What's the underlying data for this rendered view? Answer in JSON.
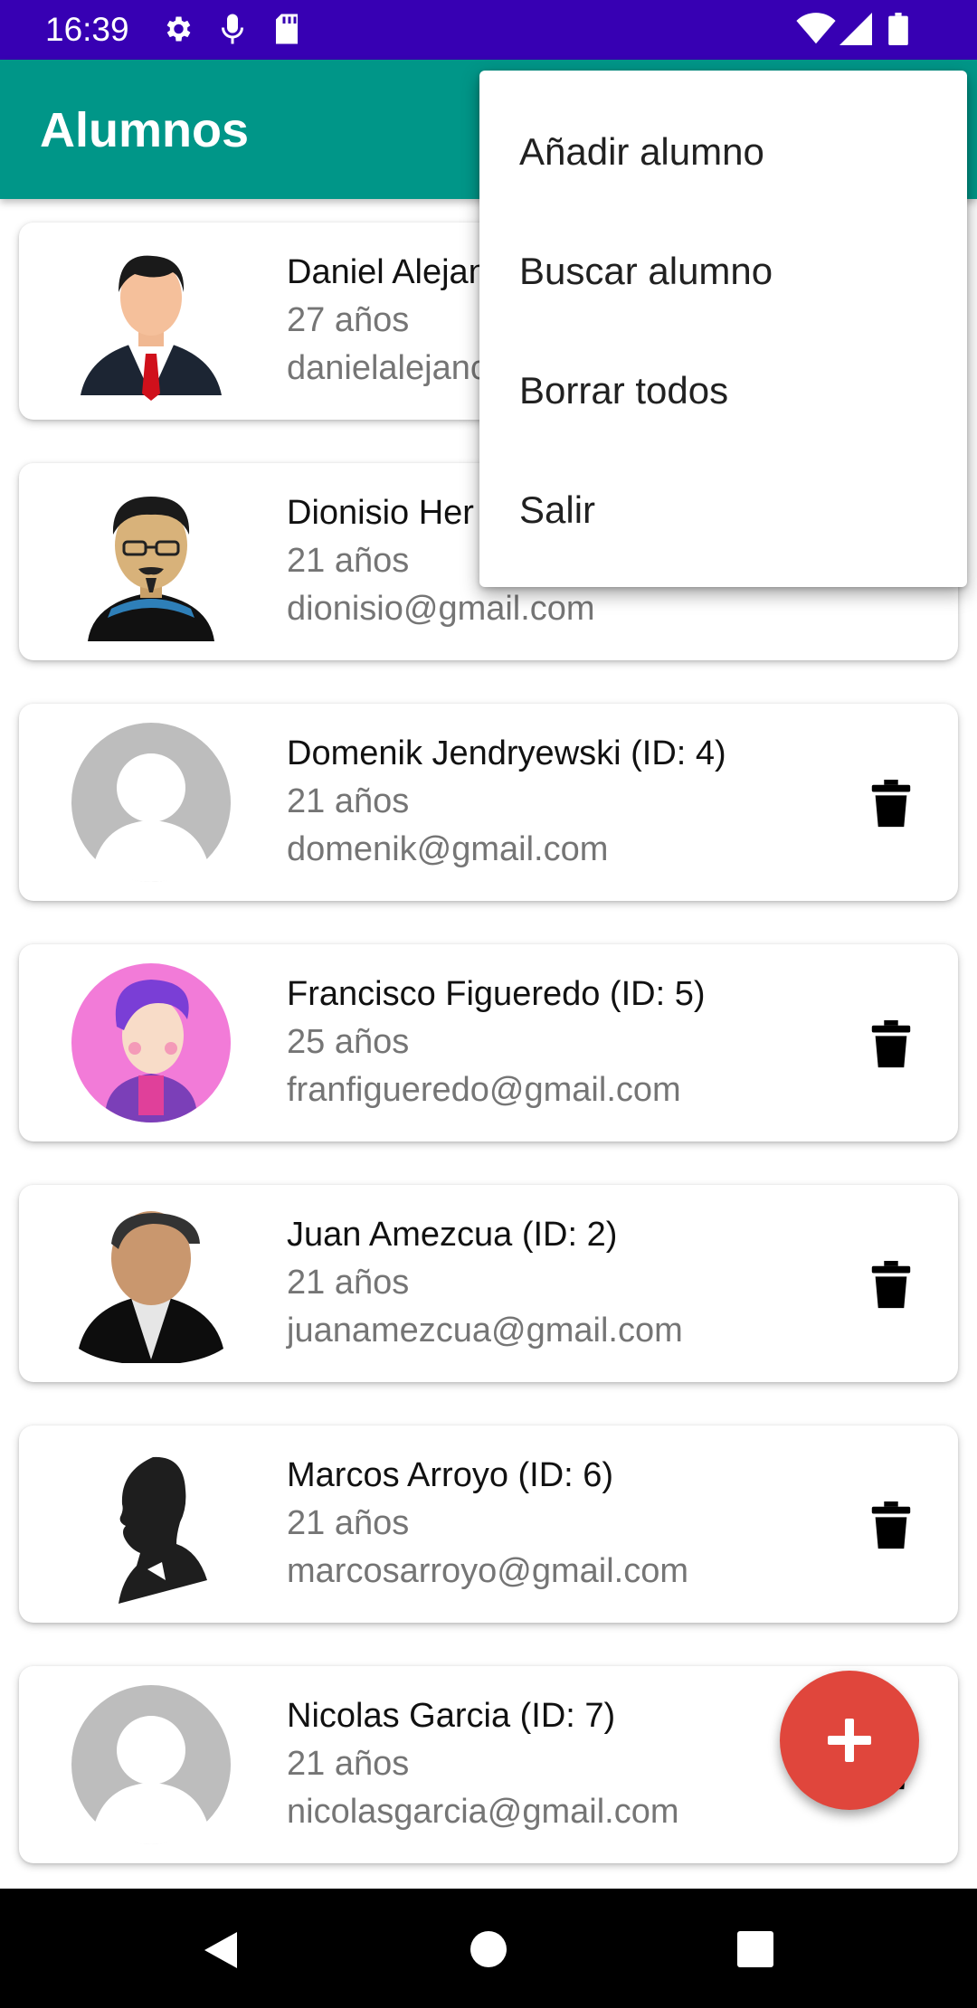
{
  "status_bar": {
    "time": "16:39",
    "icons": [
      "settings-gear-icon",
      "microphone-icon",
      "sd-card-icon",
      "wifi-icon",
      "signal-icon",
      "battery-icon"
    ]
  },
  "app_bar": {
    "title": "Alumnos"
  },
  "overflow_menu": {
    "items": [
      "Añadir alumno",
      "Buscar alumno",
      "Borrar todos",
      "Salir"
    ]
  },
  "students": [
    {
      "name": "Daniel Alejan",
      "age": "27 años",
      "email": "danielalejanc",
      "avatar": "man-in-suit-red-tie"
    },
    {
      "name": "Dionisio Her",
      "age": "21 años",
      "email": "dionisio@gmail.com",
      "avatar": "man-with-glasses-goatee"
    },
    {
      "name": "Domenik Jendryewski (ID: 4)",
      "age": "21 años",
      "email": "domenik@gmail.com",
      "avatar": "default-gray-avatar"
    },
    {
      "name": "Francisco Figueredo (ID: 5)",
      "age": "25 años",
      "email": "franfigueredo@gmail.com",
      "avatar": "cartoon-purple-hair"
    },
    {
      "name": "Juan Amezcua (ID: 2)",
      "age": "21 años",
      "email": "juanamezcua@gmail.com",
      "avatar": "man-black-jacket"
    },
    {
      "name": "Marcos Arroyo (ID: 6)",
      "age": "21 años",
      "email": "marcosarroyo@gmail.com",
      "avatar": "silhouette-profile"
    },
    {
      "name": "Nicolas Garcia (ID: 7)",
      "age": "21 años",
      "email": "nicolasgarcia@gmail.com",
      "avatar": "default-gray-avatar"
    }
  ],
  "fab": {
    "icon": "plus-icon",
    "color": "#e0463c"
  },
  "colors": {
    "status_bar": "#3700b3",
    "app_bar": "#009688",
    "accent": "#e0463c"
  },
  "nav_bar": {
    "buttons": [
      "back-triangle-icon",
      "home-circle-icon",
      "recents-square-icon"
    ]
  }
}
